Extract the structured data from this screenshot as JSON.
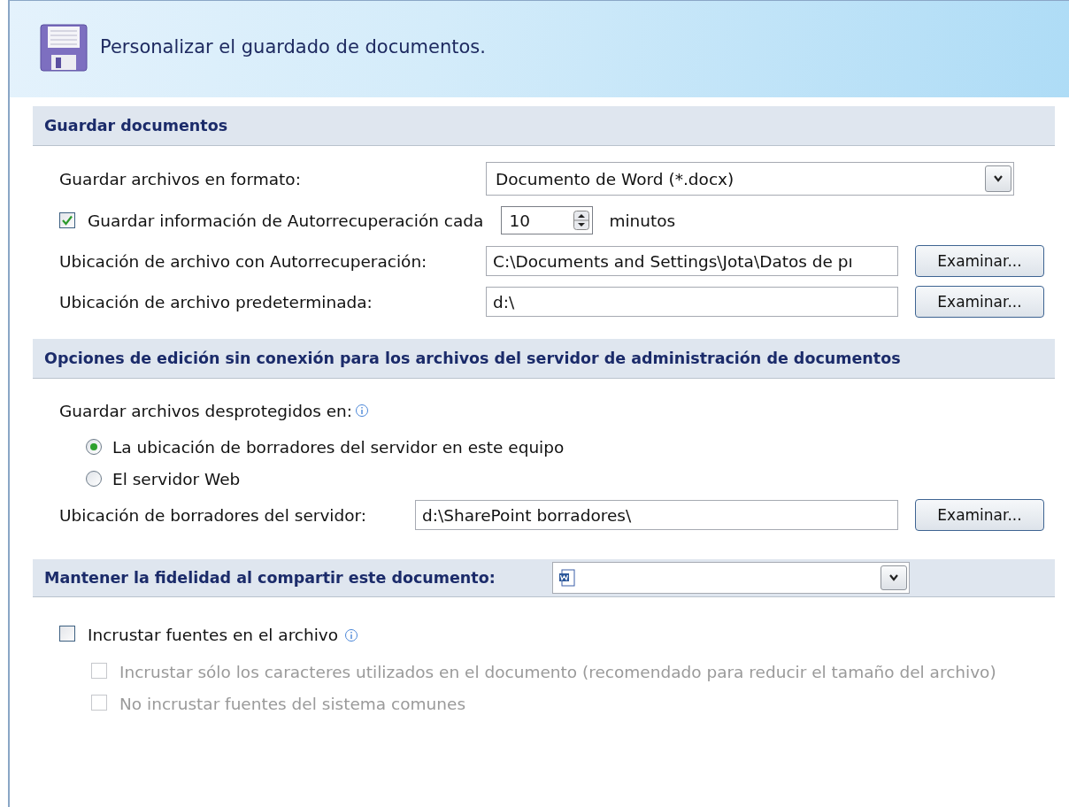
{
  "header": {
    "title": "Personalizar el guardado de documentos."
  },
  "save_section": {
    "title": "Guardar documentos",
    "format": {
      "label": "Guardar archivos en formato:",
      "value": "Documento de Word (*.docx)"
    },
    "autorecover": {
      "label": "Guardar información de Autorrecuperación cada",
      "checked": true,
      "value": "10",
      "unit": "minutos"
    },
    "paths": [
      {
        "label": "Ubicación de archivo con Autorrecuperación:",
        "value": "C:\\Documents and Settings\\Jota\\Datos de pı",
        "button": "Examinar..."
      },
      {
        "label": "Ubicación de archivo predeterminada:",
        "value": "d:\\",
        "button": "Examinar..."
      }
    ]
  },
  "offline_section": {
    "title": "Opciones de edición sin conexión para los archivos del servidor de administración de documentos",
    "save_label": "Guardar archivos desprotegidos en:",
    "options": [
      {
        "label": "La ubicación de borradores del servidor en este equipo",
        "selected": true
      },
      {
        "label": "El servidor Web",
        "selected": false
      }
    ],
    "drafts": {
      "label": "Ubicación de borradores del servidor:",
      "value": "d:\\SharePoint borradores\\",
      "button": "Examinar..."
    }
  },
  "fidelity_section": {
    "title": "Mantener la fidelidad al compartir este documento:",
    "options": [
      {
        "label": "Incrustar fuentes en el archivo",
        "checked": false,
        "disabled": false,
        "info": true,
        "children": [
          {
            "label": "Incrustar sólo los caracteres utilizados en el documento (recomendado para reducir el tamaño del archivo)",
            "checked": false,
            "disabled": true,
            "info": false
          },
          {
            "label": "No incrustar fuentes del sistema comunes",
            "checked": false,
            "disabled": true,
            "info": false
          }
        ]
      }
    ]
  }
}
